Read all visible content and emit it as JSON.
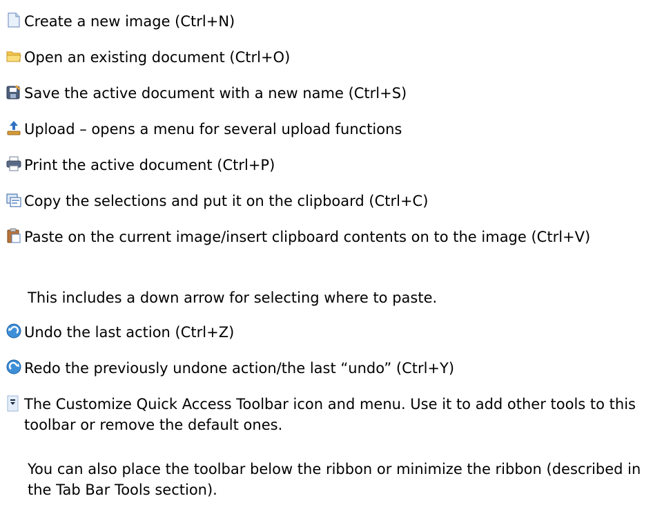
{
  "items": [
    {
      "icon": "new-document-icon",
      "text": "Create a new image (Ctrl+N)"
    },
    {
      "icon": "open-folder-icon",
      "text": "Open an existing document (Ctrl+O)"
    },
    {
      "icon": "save-as-icon",
      "text": "Save the active document with a new name (Ctrl+S)"
    },
    {
      "icon": "upload-icon",
      "text": "Upload – opens a menu for several upload functions"
    },
    {
      "icon": "printer-icon",
      "text": "Print the active document (Ctrl+P)"
    },
    {
      "icon": "copy-icon",
      "text": "Copy the selections and put it on the clipboard (Ctrl+C)"
    },
    {
      "icon": "paste-icon",
      "text": "Paste on the current image/insert clipboard contents on to the image (Ctrl+V)"
    },
    {
      "icon": "undo-icon",
      "text": "Undo the last action (Ctrl+Z)"
    },
    {
      "icon": "redo-icon",
      "text": "Redo the previously undone action/the last “undo” (Ctrl+Y)"
    },
    {
      "icon": "customize-toolbar-icon",
      "text": "The Customize Quick Access Toolbar icon and menu. Use it to add other tools to this toolbar or remove the default ones."
    }
  ],
  "notes": {
    "paste_note": "This includes a down arrow for selecting where to paste.",
    "toolbar_note": "You can also place the toolbar below the ribbon or minimize the ribbon (described in the Tab Bar Tools section)."
  }
}
